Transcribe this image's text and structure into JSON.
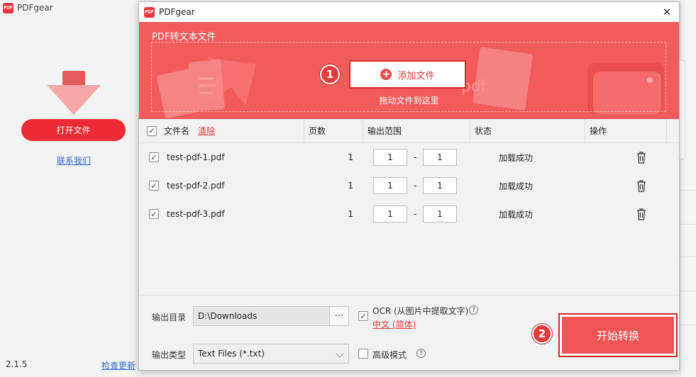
{
  "background_app": {
    "title": "PDFgear",
    "open_file_label": "打开文件",
    "contact_label": "联系我们",
    "version": "2.1.5",
    "check_update_label": "检查更新"
  },
  "dialog": {
    "title": "PDFgear",
    "hero_title": "PDF转文本文件",
    "add_file_label": "添加文件",
    "drag_hint": "拖动文件到这里",
    "hero_deco_text": "pdf",
    "step1": "1",
    "step2": "2",
    "table": {
      "headers": {
        "filename": "文件名",
        "clear": "清除",
        "pages": "页数",
        "range": "输出范围",
        "status": "状态",
        "action": "操作"
      },
      "rows": [
        {
          "name": "test-pdf-1.pdf",
          "pages": "1",
          "from": "1",
          "to": "1",
          "status": "加载成功",
          "checked": true
        },
        {
          "name": "test-pdf-2.pdf",
          "pages": "1",
          "from": "1",
          "to": "1",
          "status": "加载成功",
          "checked": true
        },
        {
          "name": "test-pdf-3.pdf",
          "pages": "1",
          "from": "1",
          "to": "1",
          "status": "加载成功",
          "checked": true
        }
      ],
      "range_sep": "-"
    },
    "footer": {
      "output_dir_label": "输出目录",
      "output_dir_value": "D:\\Downloads",
      "browse_label": "...",
      "output_type_label": "输出类型",
      "output_type_value": "Text Files (*.txt)",
      "ocr_label": "OCR (从图片中提取文字)",
      "ocr_lang": "中文 (简体)",
      "advanced_label": "高级模式",
      "help_glyph": "?",
      "start_label": "开始转换"
    }
  },
  "colors": {
    "accent": "#f15b5b",
    "button_red": "#ee2b34",
    "link_blue": "#3369c9"
  }
}
